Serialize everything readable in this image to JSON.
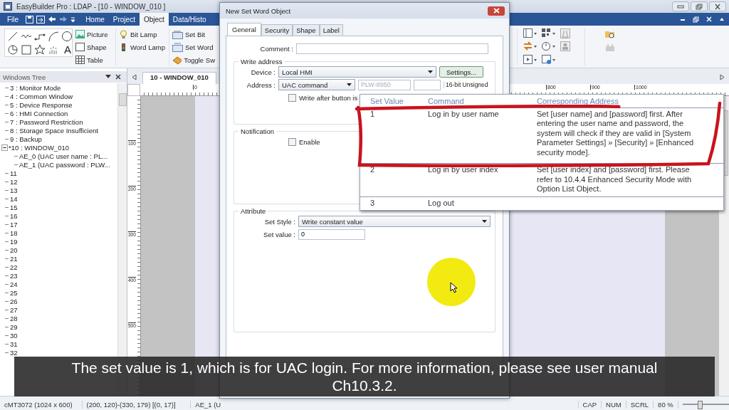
{
  "app_title": "EasyBuilder Pro : LDAP - [10 - WINDOW_010 ]",
  "ribbon_tabs": [
    {
      "label": "File",
      "selected": false
    },
    {
      "label": "Home",
      "selected": false
    },
    {
      "label": "Project",
      "selected": false
    },
    {
      "label": "Object",
      "selected": true
    },
    {
      "label": "Data/Histo",
      "selected": false
    }
  ],
  "ribbon": {
    "gallery_letter": "A",
    "groups": [
      {
        "buttons": [
          {
            "label": "Picture",
            "kind": "picture"
          },
          {
            "label": "Shape",
            "kind": "shape"
          },
          {
            "label": "Table",
            "kind": "table"
          }
        ]
      },
      {
        "buttons": [
          {
            "label": "Bit Lamp",
            "kind": "bulb"
          },
          {
            "label": "Word Lamp",
            "kind": "lamp"
          }
        ]
      },
      {
        "buttons": [
          {
            "label": "Set Bit",
            "kind": "setbit"
          },
          {
            "label": "Set Word",
            "kind": "setword"
          },
          {
            "label": "Toggle Sw",
            "kind": "toggle"
          }
        ]
      }
    ]
  },
  "windows_tree": {
    "title": "Windows Tree",
    "items": [
      {
        "label": "3 : Monitor Mode"
      },
      {
        "label": "4 : Common Window"
      },
      {
        "label": "5 : Device Response"
      },
      {
        "label": "6 : HMI Connection"
      },
      {
        "label": "7 : Password Restriction"
      },
      {
        "label": "8 : Storage Space Insufficient"
      },
      {
        "label": "9 : Backup"
      },
      {
        "label": "*10 : WINDOW_010",
        "expanded": true,
        "children": [
          {
            "label": "AE_0 (UAC user name : PL..."
          },
          {
            "label": "AE_1 (UAC password : PLW..."
          }
        ]
      },
      {
        "label": "11"
      },
      {
        "label": "12"
      },
      {
        "label": "13"
      },
      {
        "label": "14"
      },
      {
        "label": "15"
      },
      {
        "label": "16"
      },
      {
        "label": "17"
      },
      {
        "label": "18"
      },
      {
        "label": "19"
      },
      {
        "label": "20"
      },
      {
        "label": "21"
      },
      {
        "label": "22"
      },
      {
        "label": "23"
      },
      {
        "label": "24"
      },
      {
        "label": "25"
      },
      {
        "label": "26"
      },
      {
        "label": "27"
      },
      {
        "label": "28"
      },
      {
        "label": "29"
      },
      {
        "label": "30"
      },
      {
        "label": "31"
      },
      {
        "label": "32"
      }
    ]
  },
  "editor_tab": "10 - WINDOW_010",
  "ruler": {
    "top_labels": [
      "0",
      "800",
      "900",
      "1000"
    ],
    "left_labels": [
      "100",
      "200",
      "300",
      "400",
      "500"
    ]
  },
  "dialog": {
    "title": "New Set Word Object",
    "tabs": [
      {
        "label": "General",
        "selected": true
      },
      {
        "label": "Security",
        "selected": false
      },
      {
        "label": "Shape",
        "selected": false
      },
      {
        "label": "Label",
        "selected": false
      }
    ],
    "comment_label": "Comment :",
    "write_address": {
      "title": "Write address",
      "device_label": "Device :",
      "device_value": "Local HMI",
      "settings_button": "Settings...",
      "address_label": "Address :",
      "address_value": "UAC command",
      "address_field_placeholder": "PLW-8950",
      "data_type": "16-bit Unsigned",
      "write_after": {
        "label": "Write after button is",
        "checked": false
      }
    },
    "notification": {
      "title": "Notification",
      "enable": {
        "label": "Enable",
        "checked": false
      }
    },
    "attribute": {
      "title": "Attribute",
      "set_style_label": "Set Style :",
      "set_style_value": "Write constant value",
      "set_value_label": "Set value :",
      "set_value": "0"
    }
  },
  "popup_table": {
    "columns": [
      "Set Value",
      "Command",
      "Corresponding Address"
    ],
    "rows": [
      {
        "set_value": "1",
        "command": "Log in by user name",
        "address": "Set [user name] and [password] first. After entering the user name and password, the system will check if they are valid in [System Parameter Settings] » [Security] » [Enhanced security mode]."
      },
      {
        "set_value": "2",
        "command": "Log in by user index",
        "address": "Set [user index] and [password] first. Please refer to 10.4.4 Enhanced Security Mode with Option List Object."
      },
      {
        "set_value": "3",
        "command": "Log out",
        "address": ""
      }
    ]
  },
  "subtitle": "The set value is 1, which is for UAC login. For more information, please see user manual Ch10.3.2.",
  "status_bar": {
    "sections": [
      "cMT3072 (1024 x 600)",
      "(200, 120)-(330, 179) [(0, 17)]",
      "AE_1 (U",
      "CAP",
      "NUM",
      "SCRL",
      "80 %"
    ],
    "zoom_slider": {
      "level": 0.34
    }
  }
}
